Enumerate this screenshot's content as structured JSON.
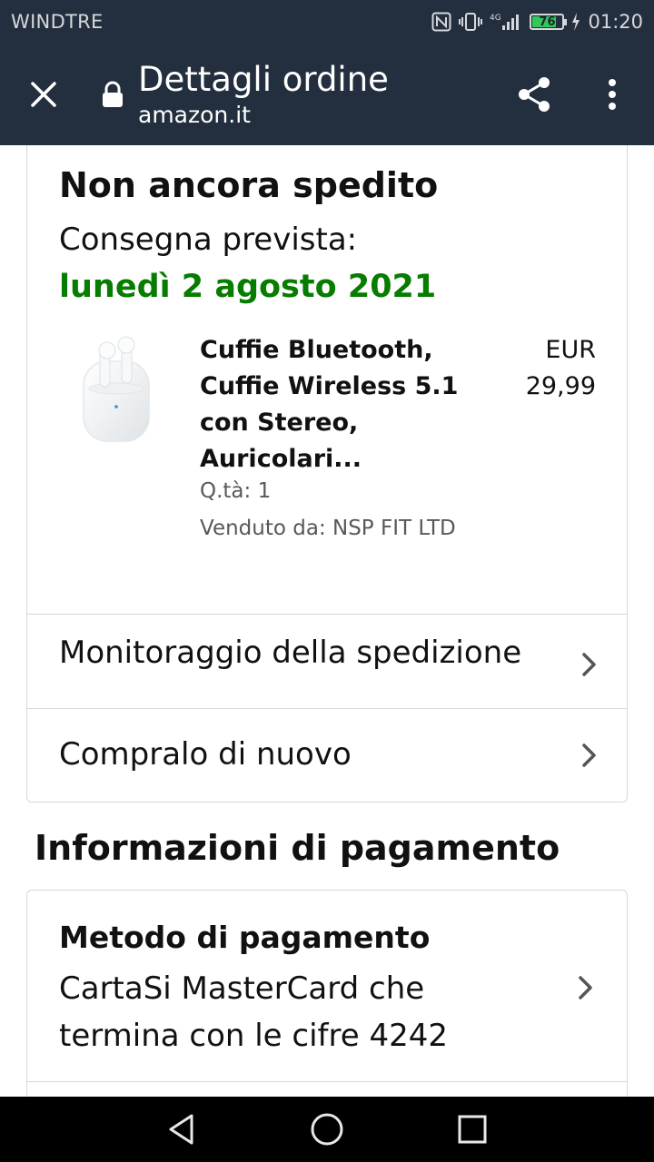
{
  "status_bar": {
    "carrier": "WINDTRE",
    "network": "4G",
    "battery_level": "76",
    "time": "01:20"
  },
  "toolbar": {
    "title": "Dettagli ordine",
    "url": "amazon.it",
    "icons": [
      "close-icon",
      "lock-icon",
      "share-icon",
      "more-vert-icon"
    ]
  },
  "order": {
    "status": "Non ancora spedito",
    "delivery_label": "Consegna prevista:",
    "delivery_date": "lunedì 2 agosto 2021",
    "item": {
      "title": "Cuffie Bluetooth, Cuffie Wireless 5.1 con Stereo, Auricolari...",
      "currency": "EUR",
      "price": "29,99",
      "quantity": "Q.tà: 1",
      "seller": "Venduto da: NSP FIT LTD"
    }
  },
  "actions": {
    "track": "Monitoraggio della spedizione",
    "buy_again": "Compralo di nuovo"
  },
  "payment": {
    "heading": "Informazioni di pagamento",
    "method_title": "Metodo di pagamento",
    "method_detail": "CartaSi MasterCard che termina con le cifre 4242"
  },
  "colors": {
    "header_bg": "#232f3e",
    "delivery_green": "#067d00",
    "border": "#d5d9d9",
    "secondary_text": "#565959"
  }
}
